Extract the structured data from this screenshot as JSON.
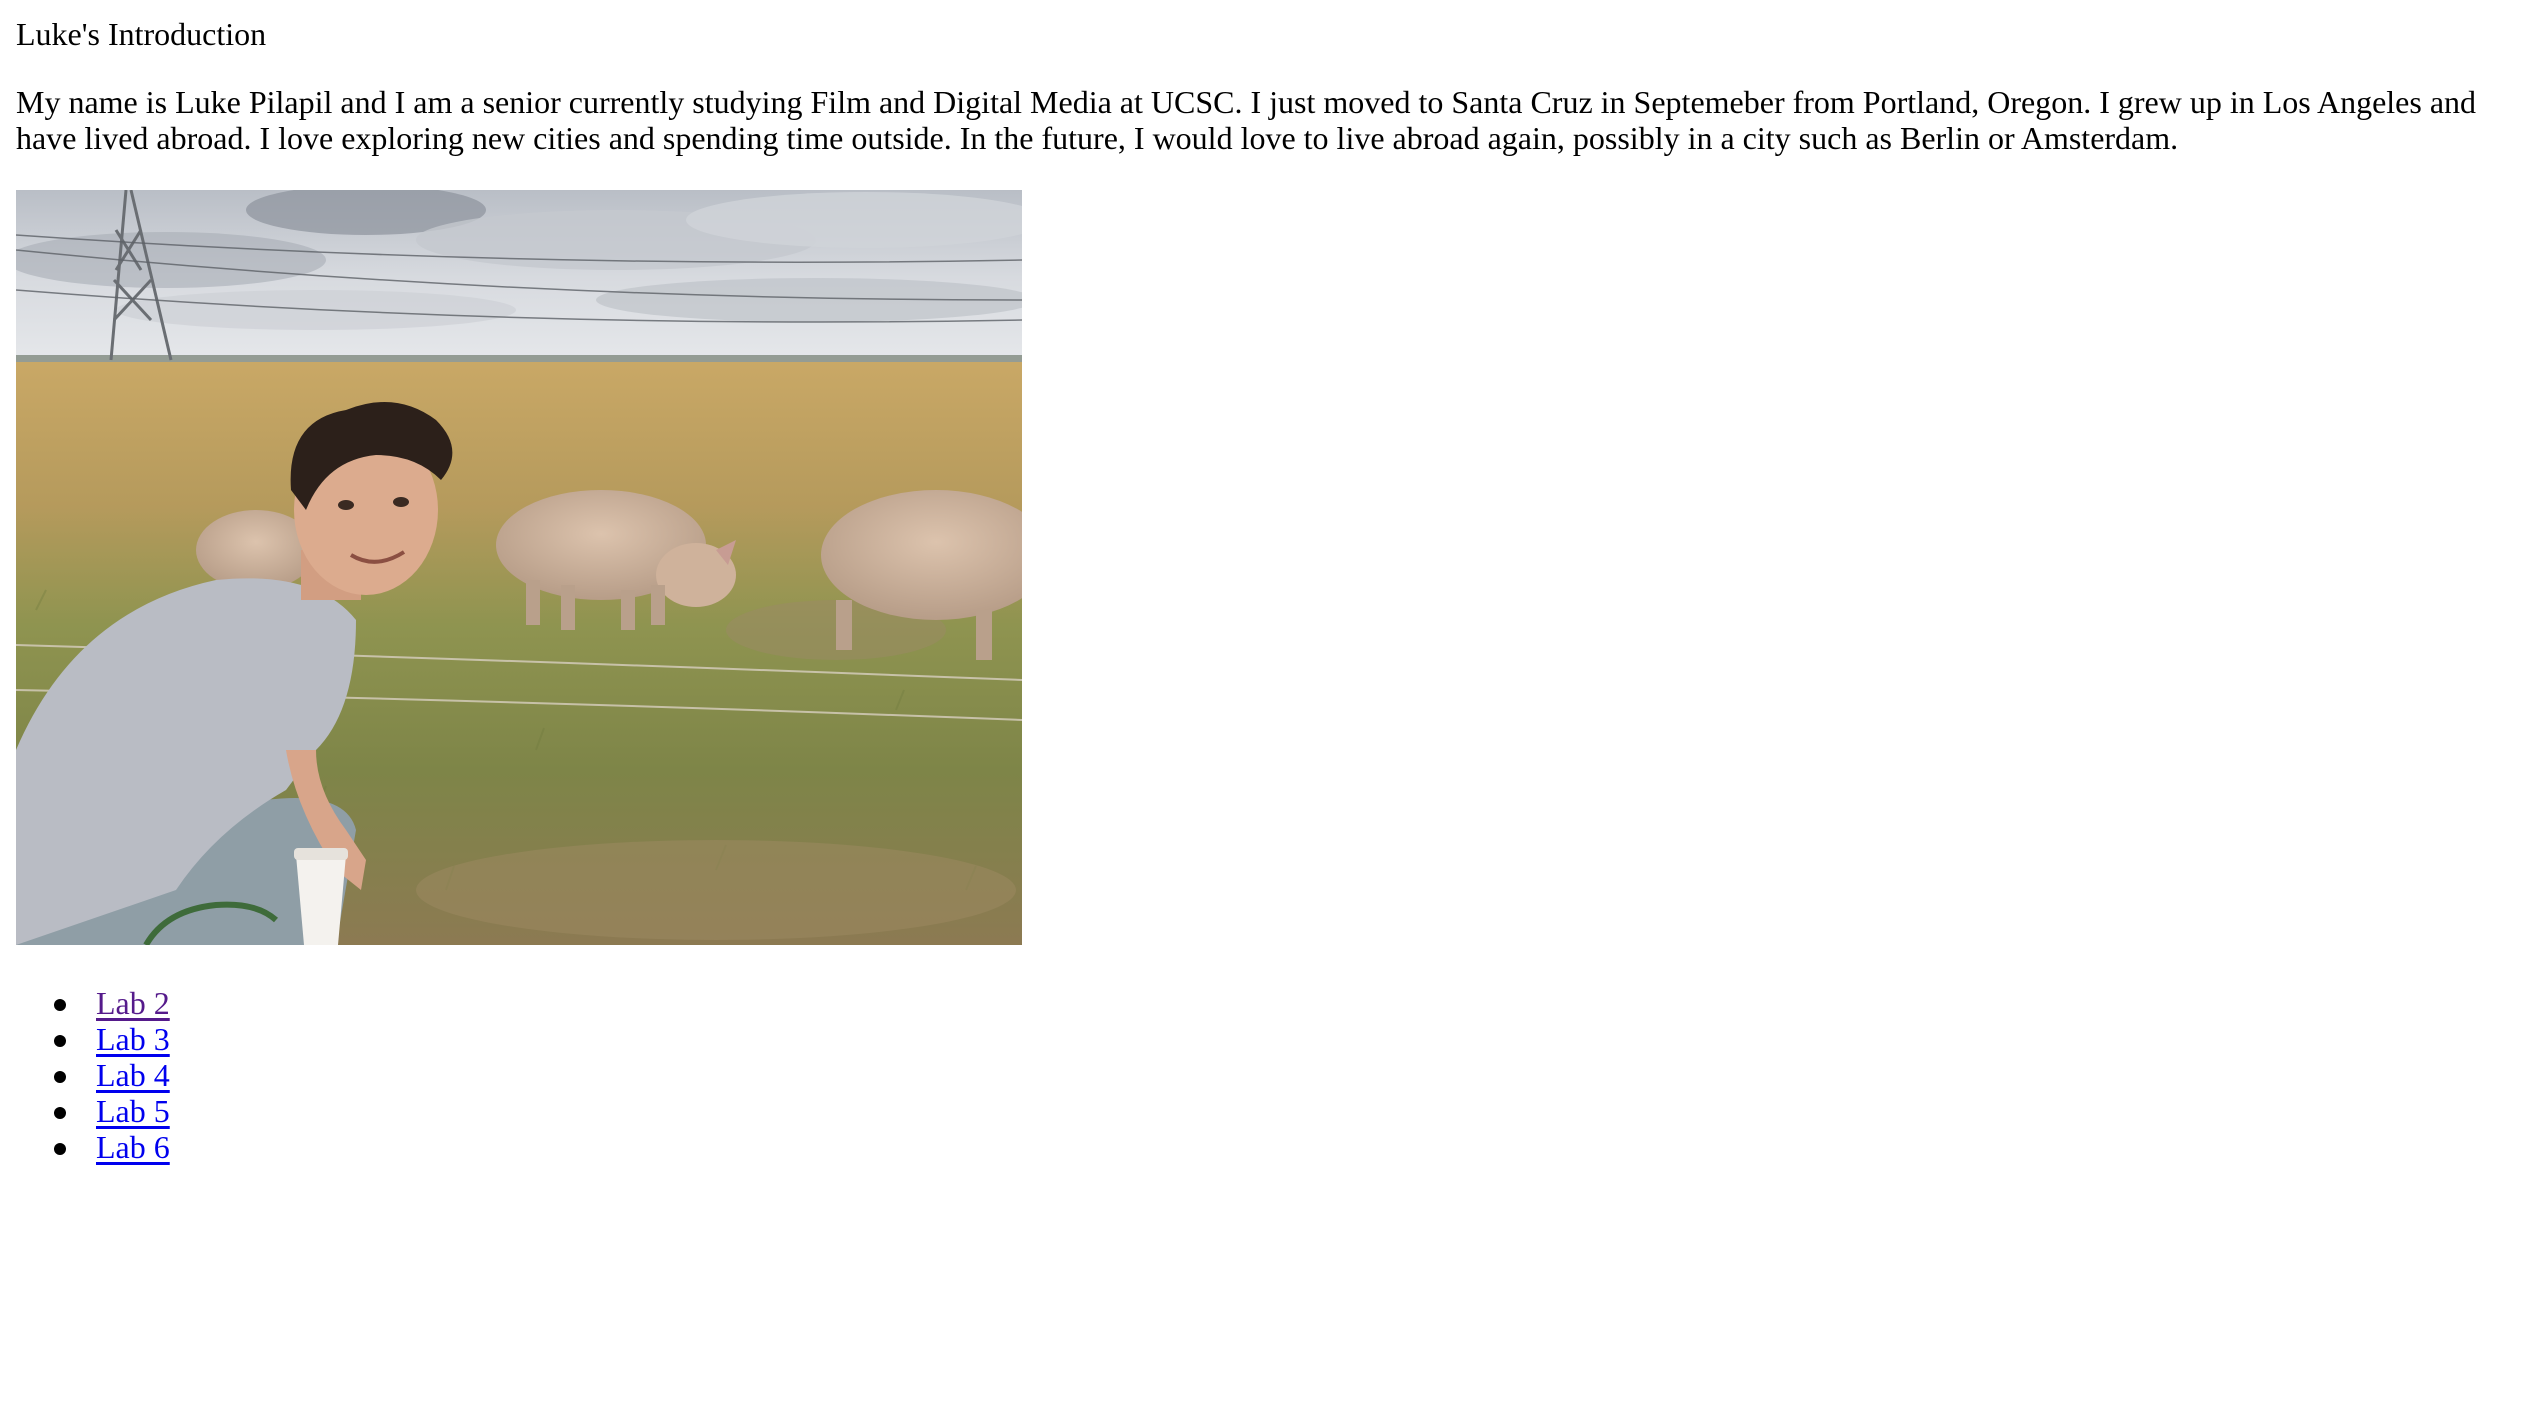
{
  "page": {
    "title": "Luke's Introduction",
    "intro": "My name is Luke Pilapil and I am a senior currently studying Film and Digital Media at UCSC. I just moved to Santa Cruz in Septemeber from Portland, Oregon. I grew up in Los Angeles and have lived abroad. I love exploring new cities and spending time outside. In the future, I would love to live abroad again, possibly in a city such as Berlin or Amsterdam."
  },
  "links": [
    {
      "label": "Lab 2",
      "state": "visited"
    },
    {
      "label": "Lab 3",
      "state": "unvisited"
    },
    {
      "label": "Lab 4",
      "state": "unvisited"
    },
    {
      "label": "Lab 5",
      "state": "unvisited"
    },
    {
      "label": "Lab 6",
      "state": "unvisited"
    }
  ],
  "colors": {
    "link": "#0000ee",
    "visited_link": "#551a8b",
    "text": "#000000",
    "background": "#ffffff"
  }
}
